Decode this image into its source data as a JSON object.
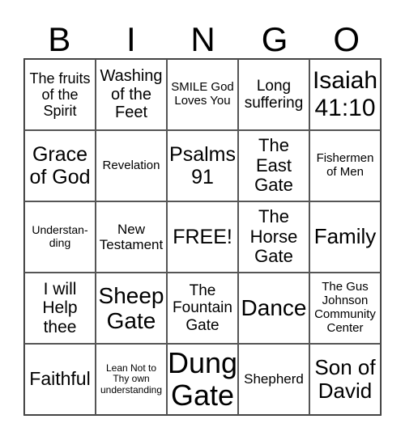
{
  "header": [
    "B",
    "I",
    "N",
    "G",
    "O"
  ],
  "cells": [
    [
      "The fruits of the Spirit",
      "Washing of the Feet",
      "SMILE God Loves You",
      "Long suffering",
      "Isaiah 41:10"
    ],
    [
      "Grace of God",
      "Revelation",
      "Psalms 91",
      "The East Gate",
      "Fishermen of Men"
    ],
    [
      "Understan-ding",
      "New Testament",
      "FREE!",
      "The Horse Gate",
      "Family"
    ],
    [
      "I will Help thee",
      "Sheep Gate",
      "The Fountain Gate",
      "Dance",
      "The Gus Johnson Community Center"
    ],
    [
      "Faithful",
      "Lean Not to Thy own understanding",
      "Dung Gate",
      "Shepherd",
      "Son of David"
    ]
  ]
}
